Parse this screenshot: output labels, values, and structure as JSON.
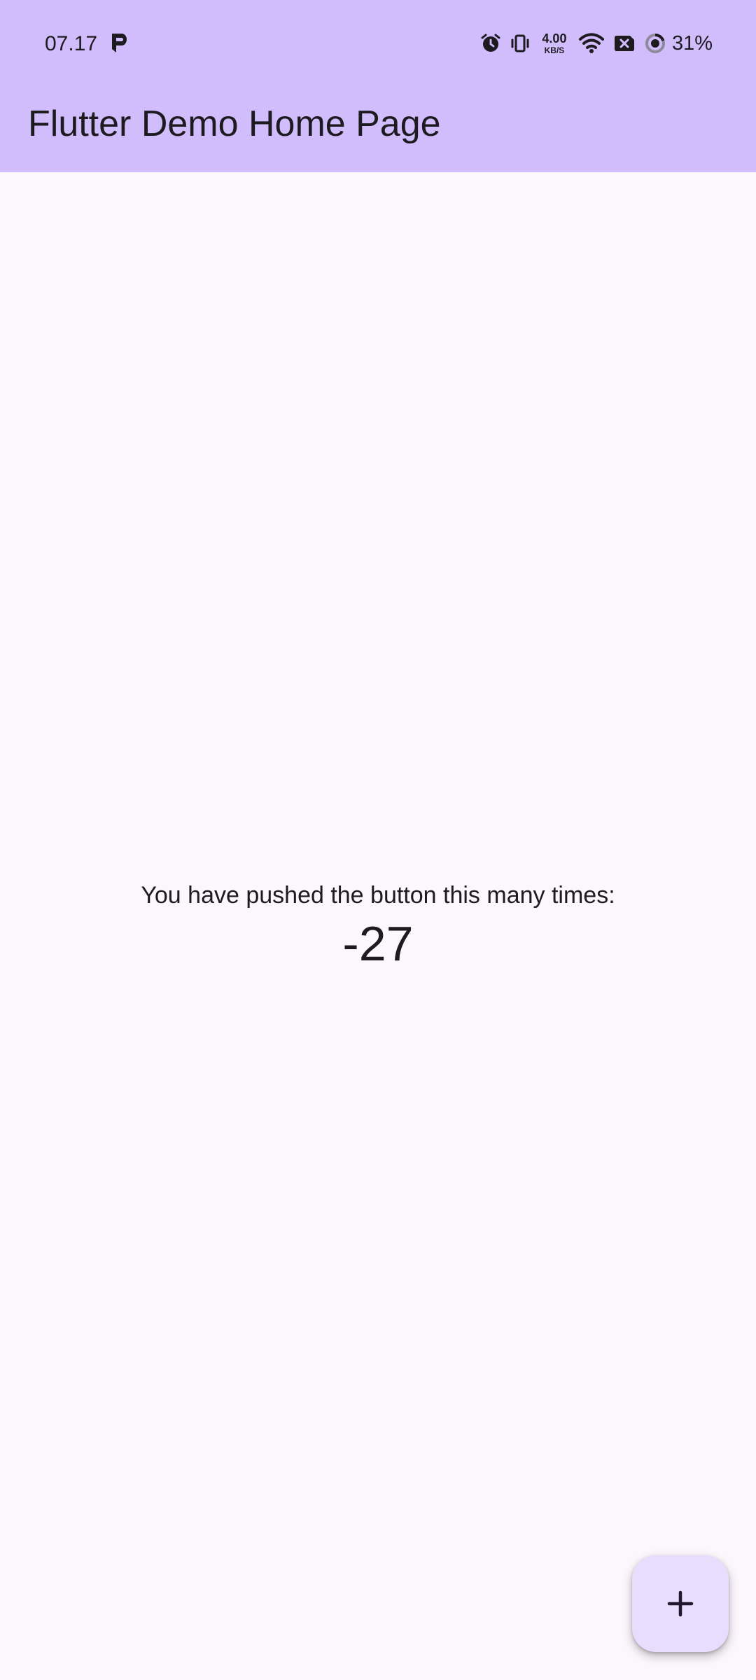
{
  "status_bar": {
    "time": "07.17",
    "left_icon": "p-notification-icon",
    "icons": [
      "alarm-icon",
      "vibrate-icon",
      "network-speed-indicator",
      "wifi-icon",
      "sim-x-icon",
      "battery-ring-icon"
    ],
    "network_speed": {
      "value": "4.00",
      "unit": "KB/S"
    },
    "battery": "31%"
  },
  "app_bar": {
    "title": "Flutter Demo Home Page",
    "background": "#d1bdfc"
  },
  "main": {
    "label": "You have pushed the button this many times:",
    "counter": "-27",
    "background": "#fcf6fd"
  },
  "fab": {
    "icon": "plus-icon",
    "background": "#eadcfc"
  }
}
